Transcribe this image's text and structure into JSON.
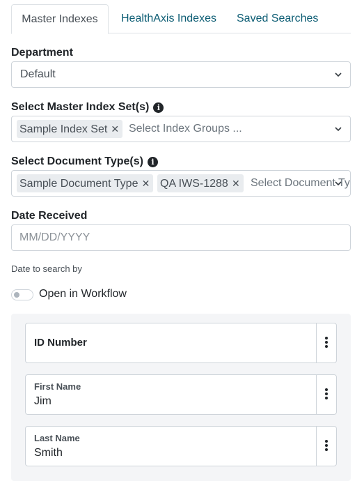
{
  "tabs": [
    {
      "label": "Master Indexes",
      "active": true
    },
    {
      "label": "HealthAxis Indexes",
      "active": false
    },
    {
      "label": "Saved Searches",
      "active": false
    }
  ],
  "department": {
    "label": "Department",
    "value": "Default"
  },
  "master_index_sets": {
    "label": "Select Master Index Set(s)",
    "selected": [
      "Sample Index Set"
    ],
    "placeholder": "Select Index Groups ..."
  },
  "document_types": {
    "label": "Select Document Type(s)",
    "selected": [
      "Sample Document Type",
      "QA IWS-1288"
    ],
    "placeholder": "Select Document Ty"
  },
  "date_received": {
    "label": "Date Received",
    "placeholder": "MM/DD/YYYY",
    "helper": "Date to search by"
  },
  "workflow_toggle": {
    "label": "Open in Workflow",
    "on": false
  },
  "fields": {
    "id_number": {
      "label": "ID Number"
    },
    "first_name": {
      "label": "First Name",
      "value": "Jim"
    },
    "last_name": {
      "label": "Last Name",
      "value": "Smith"
    }
  },
  "icons": {
    "info": "info-icon",
    "chevron": "chevron-down-icon",
    "remove": "close-icon",
    "menu": "kebab-menu-icon"
  },
  "colors": {
    "tab_link": "#0b5c73",
    "panel_bg": "#f4f5f7",
    "border": "#ced4da"
  }
}
